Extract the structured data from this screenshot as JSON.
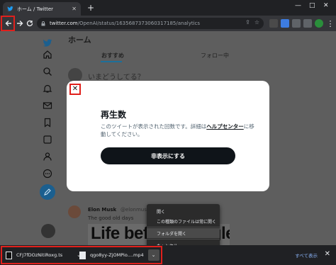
{
  "browser": {
    "tab_title": "ホーム / Twitter",
    "new_tab": "+",
    "url_host": "twitter.com",
    "url_path": "/OpenAI/status/1635687373060317185/analytics",
    "window_controls": [
      "—",
      "□",
      "✕"
    ]
  },
  "page": {
    "title": "ホーム",
    "tabs": [
      "おすすめ",
      "フォロー中"
    ],
    "compose_placeholder": "いまどうしてる？",
    "tweet": {
      "name": "Elon Musk",
      "handle": "@elonmus",
      "text": "The good old days",
      "image_text": "Life before Google Maps"
    }
  },
  "modal": {
    "close": "✕",
    "title": "再生数",
    "body_before": "このツイートが表示された回数です。詳細は",
    "body_link": "ヘルプセンター",
    "body_after": "に移動してください。",
    "button": "非表示にする"
  },
  "context_menu": {
    "items": [
      "開く",
      "この種類のファイルは常に開く",
      "フォルダを開く",
      "キャンセル"
    ]
  },
  "downloads": {
    "items": [
      {
        "name": "CFJ7fDOzNitiRoxg.ts"
      },
      {
        "name": "qgo8yy-ZjOMPio....mp4"
      }
    ],
    "show_all": "すべて表示",
    "close": "✕"
  },
  "colors": {
    "highlight": "#e0201c",
    "twitter_blue": "#1d9bf0",
    "modal_button": "#0f1419"
  },
  "icons": [
    "back-arrow-icon",
    "forward-arrow-icon",
    "reload-icon",
    "lock-icon",
    "twitter-bird-icon",
    "home-icon",
    "search-icon",
    "bell-icon",
    "mail-icon",
    "bookmark-icon",
    "twitter-blue-icon",
    "profile-icon",
    "more-icon",
    "compose-icon"
  ]
}
